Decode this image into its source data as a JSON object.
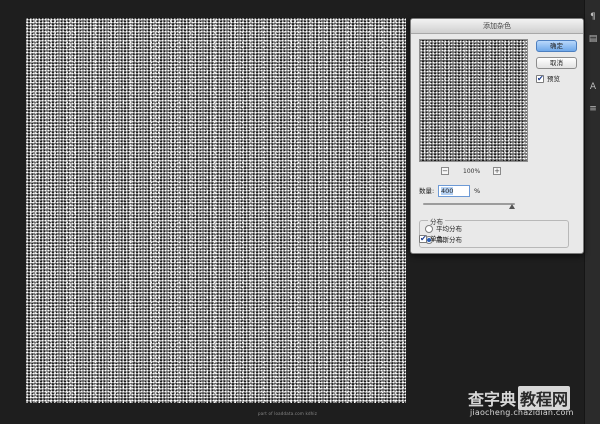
{
  "dialog": {
    "title": "添加杂色",
    "ok_label": "确定",
    "cancel_label": "取消",
    "preview_label": "预览",
    "preview_checked": true,
    "zoom_out_label": "−",
    "zoom_in_label": "+",
    "zoom_value": "100%",
    "amount_label": "数量:",
    "amount_value": "400",
    "amount_unit": "%",
    "amount_slider_fraction": 0.97,
    "distribution_label": "分布",
    "distribution_options": [
      {
        "label": "平均分布",
        "selected": false
      },
      {
        "label": "高斯分布",
        "selected": true
      }
    ],
    "monochrome_label": "单色",
    "monochrome_checked": true
  },
  "canvas": {
    "credit": "part of loaddata.com kdhiz"
  },
  "right_strip": {
    "icons": [
      "paragraph-icon",
      "panel-icon",
      "text-icon",
      "layers-icon"
    ]
  },
  "watermark": {
    "brand_a": "查字典",
    "brand_b": "教程网",
    "url": "jiaocheng.chazidian.com"
  }
}
